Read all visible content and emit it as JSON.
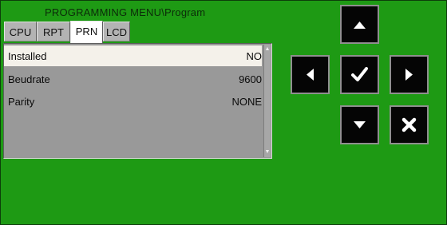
{
  "title": "PROGRAMMING MENU\\Program",
  "tabs": [
    {
      "label": "CPU"
    },
    {
      "label": "RPT"
    },
    {
      "label": "PRN"
    },
    {
      "label": "LCD"
    }
  ],
  "active_tab": "PRN",
  "rows": [
    {
      "label": "Installed",
      "value": "NO"
    },
    {
      "label": "Beudrate",
      "value": "9600"
    },
    {
      "label": "Parity",
      "value": "NONE"
    }
  ],
  "selected_row": "Installed",
  "scrollbar": {
    "up_glyph": "▲",
    "down_glyph": "▼"
  },
  "buttons": {
    "up": "arrow-up-icon",
    "left": "arrow-left-icon",
    "confirm": "checkmark-icon",
    "right": "arrow-right-icon",
    "down": "arrow-down-icon",
    "cancel": "x-icon"
  },
  "colors": {
    "screen_bg": "#1e9a14",
    "panel_bg": "#999999",
    "selected_row_bg": "#f4f1ea",
    "button_bg": "#050505",
    "button_glyph": "#ffffff"
  }
}
